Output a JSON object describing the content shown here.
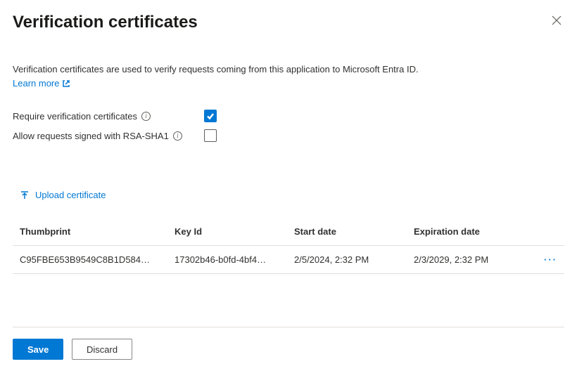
{
  "header": {
    "title": "Verification certificates"
  },
  "description": {
    "text": "Verification certificates are used to verify requests coming from this application to Microsoft Entra ID.",
    "learn_more": "Learn more"
  },
  "settings": {
    "require_label": "Require verification certificates",
    "require_checked": true,
    "allow_rsa_label": "Allow requests signed with RSA-SHA1",
    "allow_rsa_checked": false
  },
  "upload": {
    "label": "Upload certificate"
  },
  "table": {
    "headers": {
      "thumbprint": "Thumbprint",
      "key_id": "Key Id",
      "start_date": "Start date",
      "expiration_date": "Expiration date"
    },
    "rows": [
      {
        "thumbprint": "C95FBE653B9549C8B1D584…",
        "key_id": "17302b46-b0fd-4bf4…",
        "start_date": "2/5/2024, 2:32 PM",
        "expiration_date": "2/3/2029, 2:32 PM"
      }
    ]
  },
  "footer": {
    "save": "Save",
    "discard": "Discard"
  }
}
